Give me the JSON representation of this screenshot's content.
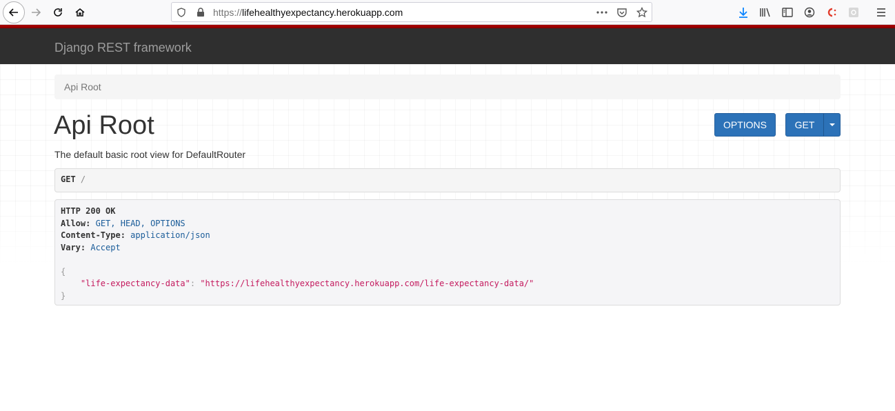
{
  "browser": {
    "url_protocol": "https://",
    "url_host": "lifehealthyexpectancy.herokuapp.com",
    "icons": [
      "back-icon",
      "forward-icon",
      "reload-icon",
      "home-icon",
      "shield-icon",
      "lock-icon",
      "more-icon",
      "pocket-icon",
      "star-icon",
      "download-icon",
      "library-icon",
      "sidebar-icon",
      "account-icon",
      "extension-icon",
      "extension-gear-icon",
      "menu-icon"
    ]
  },
  "navbar": {
    "brand": "Django REST framework"
  },
  "breadcrumb": {
    "current": "Api Root"
  },
  "page": {
    "title": "Api Root",
    "description": "The default basic root view for DefaultRouter"
  },
  "actions": {
    "options_label": "OPTIONS",
    "get_label": "GET"
  },
  "request": {
    "method": "GET",
    "path": "/"
  },
  "response": {
    "status": "HTTP 200 OK",
    "headers": [
      {
        "key": "Allow:",
        "value": "GET, HEAD, OPTIONS"
      },
      {
        "key": "Content-Type:",
        "value": "application/json"
      },
      {
        "key": "Vary:",
        "value": "Accept"
      }
    ],
    "open_brace": "{",
    "body_key": "\"life-expectancy-data\"",
    "body_sep": ": ",
    "body_value": "\"https://lifehealthyexpectancy.herokuapp.com/life-expectancy-data/\"",
    "close_brace": "}"
  },
  "colors": {
    "navbar_bg": "#2f2f2f",
    "navbar_accent": "#a30000",
    "button_primary": "#2c72b8",
    "json_string": "#c41a5e",
    "header_value": "#1a5c99"
  }
}
